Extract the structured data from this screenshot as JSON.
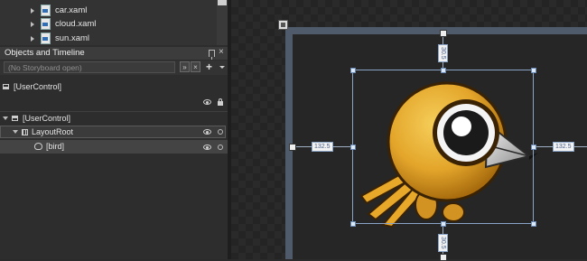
{
  "project_files": [
    {
      "name": "car.xaml"
    },
    {
      "name": "cloud.xaml"
    },
    {
      "name": "sun.xaml"
    }
  ],
  "objects_panel": {
    "title": "Objects and Timeline",
    "storyboard_placeholder": "(No Storyboard open)",
    "btn_a": "»",
    "btn_b": "×",
    "add_label": "+"
  },
  "tree": {
    "scope_label": "[UserControl]",
    "root_label": "[UserControl]",
    "layout_root": "LayoutRoot",
    "bird": "[bird]"
  },
  "canvas": {
    "margin_left": "132.5",
    "margin_right": "132.5",
    "margin_top": "30.5",
    "margin_bottom": "30.5"
  },
  "colors": {
    "bird_body": "#e3a52a",
    "bird_dark": "#8a5a0c",
    "selection": "#8aa4c8"
  }
}
